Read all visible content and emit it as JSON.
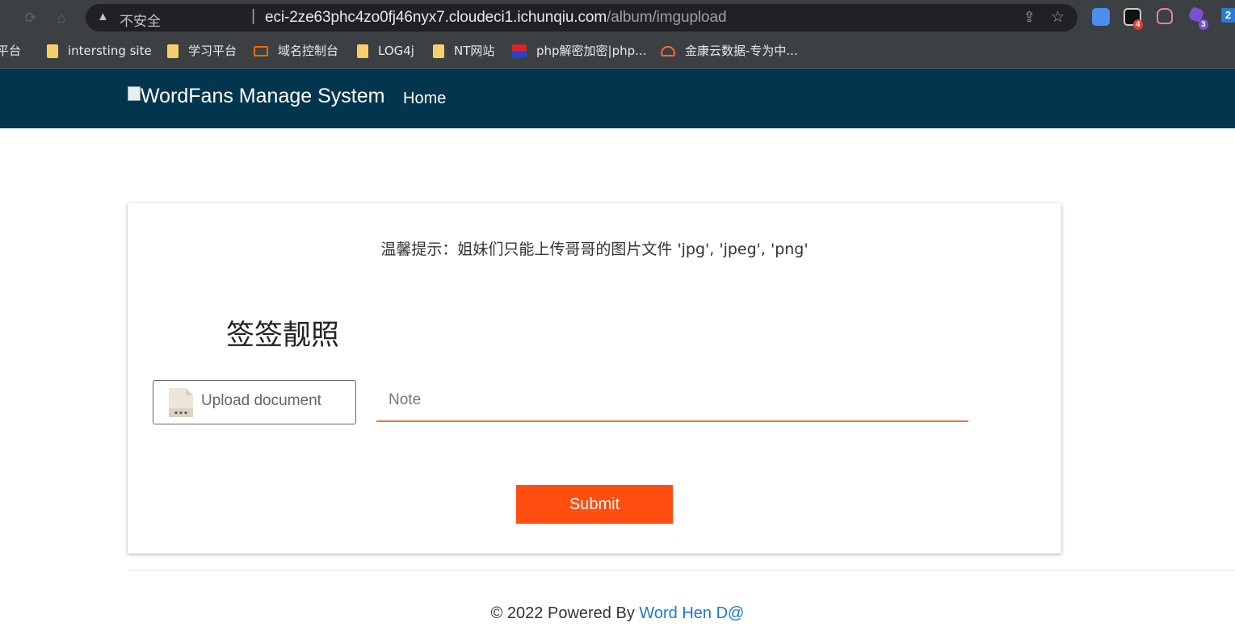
{
  "browser": {
    "security_label": "不安全",
    "url_host": "eci-2ze63phc4zo0fj46nyx7.cloudeci1.ichunqiu.com",
    "url_path": "/album/imgupload",
    "extension_badges": [
      "4",
      "3",
      "2"
    ]
  },
  "bookmarks": [
    {
      "label": "平台",
      "icon": "folder-icon"
    },
    {
      "label": "intersting site",
      "icon": "folder-icon"
    },
    {
      "label": "学习平台",
      "icon": "folder-icon"
    },
    {
      "label": "域名控制台",
      "icon": "aliyun-icon"
    },
    {
      "label": "LOG4j",
      "icon": "folder-icon"
    },
    {
      "label": "NT网站",
      "icon": "folder-icon"
    },
    {
      "label": "php解密加密|php...",
      "icon": "php-site-icon"
    },
    {
      "label": "金康云数据-专为中...",
      "icon": "cloud-icon"
    }
  ],
  "site": {
    "brand_alt": "Word",
    "brand_text": "Fans Manage System",
    "nav_home": "Home"
  },
  "form": {
    "tip": "温馨提示：姐妹们只能上传哥哥的图片文件 'jpg', 'jpeg', 'png'",
    "title": "签签靓照",
    "upload_label": "Upload document",
    "note_placeholder": "Note",
    "submit_label": "Submit"
  },
  "footer": {
    "prefix": "© 2022 Powered By ",
    "link_text": "Word Hen D@"
  },
  "colors": {
    "header_bg": "#02364f",
    "submit_bg": "#ff4e0f",
    "note_underline": "#e07a3a",
    "footer_link": "#1e78c8"
  }
}
